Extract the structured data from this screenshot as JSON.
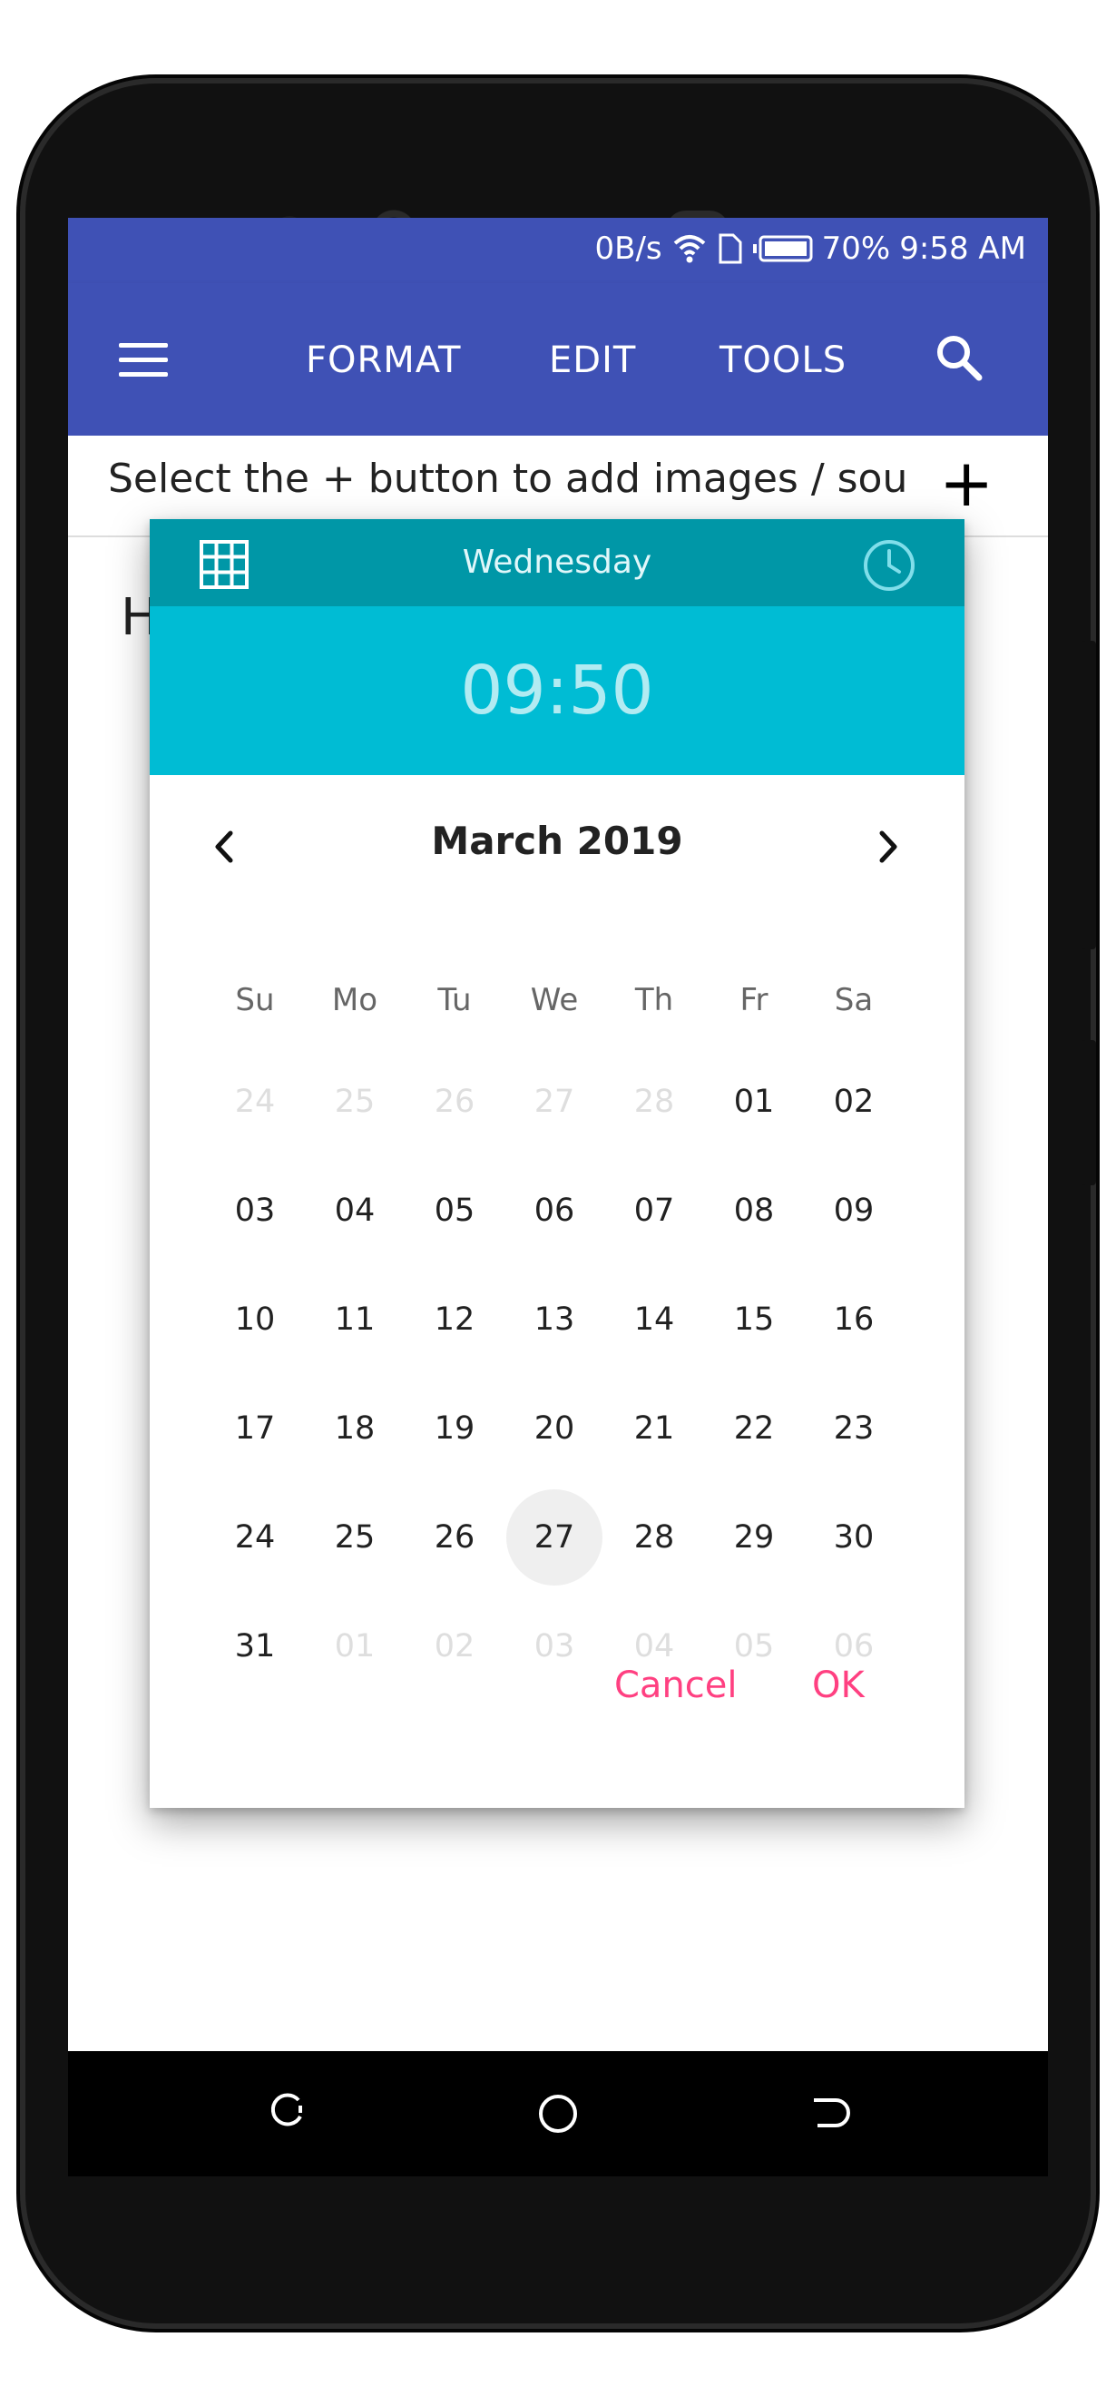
{
  "status": {
    "speed": "0B/s",
    "battery": "70%",
    "time": "9:58 AM"
  },
  "toolbar": {
    "format": "FORMAT",
    "edit": "EDIT",
    "tools": "TOOLS"
  },
  "editor": {
    "hint": "Select the + button to add images / sou",
    "plus": "+",
    "partial_text": "H"
  },
  "picker": {
    "weekday": "Wednesday",
    "time": "09:50",
    "month": "March 2019",
    "dow": [
      "Su",
      "Mo",
      "Tu",
      "We",
      "Th",
      "Fr",
      "Sa"
    ],
    "weeks": [
      [
        "24",
        "25",
        "26",
        "27",
        "28",
        "01",
        "02"
      ],
      [
        "03",
        "04",
        "05",
        "06",
        "07",
        "08",
        "09"
      ],
      [
        "10",
        "11",
        "12",
        "13",
        "14",
        "15",
        "16"
      ],
      [
        "17",
        "18",
        "19",
        "20",
        "21",
        "22",
        "23"
      ],
      [
        "24",
        "25",
        "26",
        "27",
        "28",
        "29",
        "30"
      ],
      [
        "31",
        "01",
        "02",
        "03",
        "04",
        "05",
        "06"
      ]
    ],
    "selected": "27",
    "cancel": "Cancel",
    "ok": "OK"
  },
  "colors": {
    "appbar": "#3f51b5",
    "dialog_header": "#0097a7",
    "time_band": "#00bcd4",
    "accent": "#ff4081"
  },
  "icons": [
    "menu-icon",
    "search-icon",
    "calendar-grid-icon",
    "clock-icon",
    "chevron-left-icon",
    "chevron-right-icon",
    "recent-apps-icon",
    "home-icon",
    "back-icon",
    "wifi-icon",
    "sim-icon",
    "battery-icon"
  ]
}
